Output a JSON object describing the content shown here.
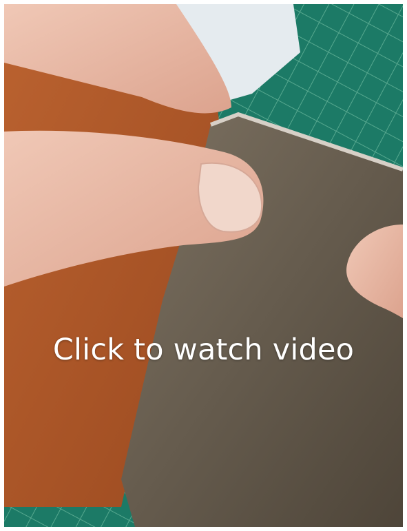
{
  "video": {
    "overlay_text": "Click to watch video",
    "thumbnail_subject": "hands holding orange and grey-brown leather samples over a green cutting mat"
  },
  "colors": {
    "page_background": "#ffffff",
    "cutting_mat": "#1f7a66",
    "orange_leather": "#b35a2c",
    "taupe_leather": "#6f6455",
    "skin": "#e6b9a7",
    "caption_text": "#ffffff"
  }
}
